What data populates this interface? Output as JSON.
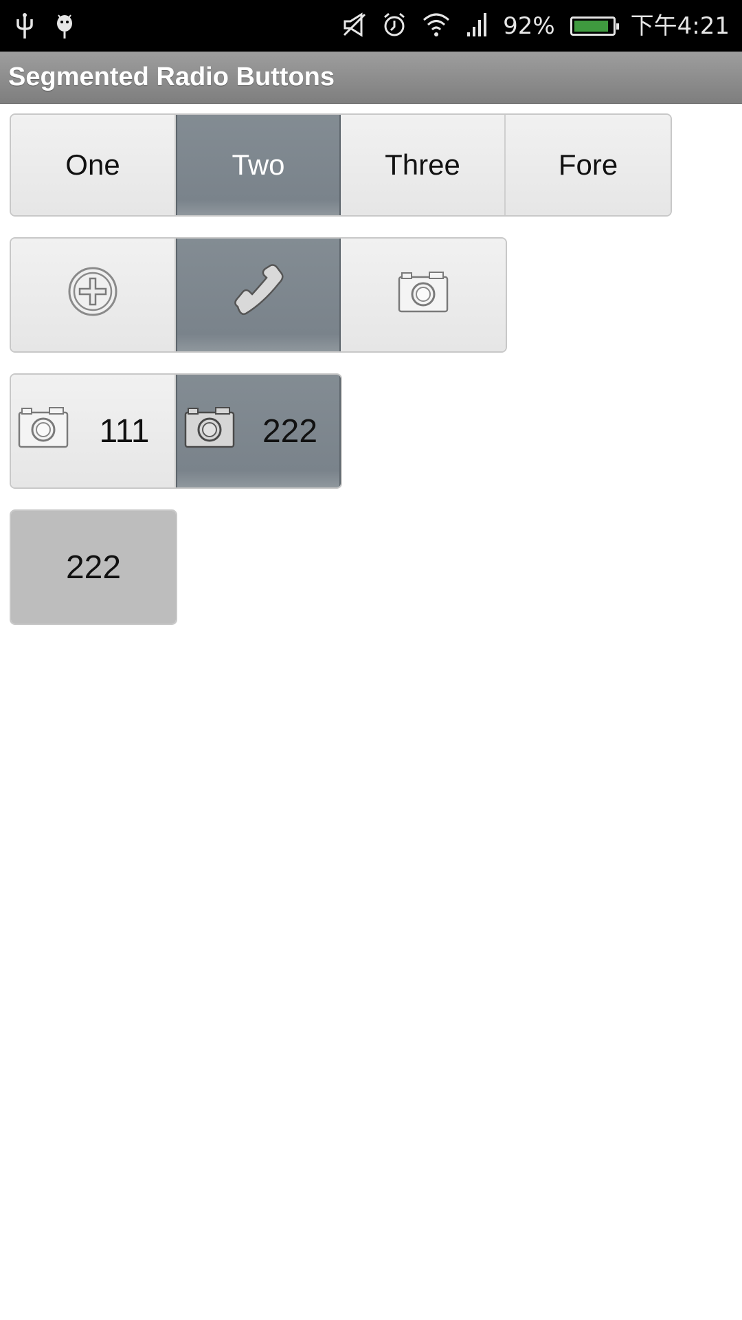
{
  "status_bar": {
    "battery_percent": "92%",
    "battery_level": 0.92,
    "time": "下午4:21",
    "icons": [
      "usb-icon",
      "android-debug-icon",
      "mute-icon",
      "alarm-icon",
      "wifi-icon",
      "signal-icon",
      "battery-icon"
    ]
  },
  "app": {
    "title": "Segmented Radio Buttons"
  },
  "group1": {
    "segments": [
      "One",
      "Two",
      "Three",
      "Fore"
    ],
    "selected_index": 1
  },
  "group2": {
    "segments": [
      "add-icon",
      "phone-icon",
      "camera-icon"
    ],
    "selected_index": 1
  },
  "group3": {
    "segments": [
      "111",
      "222"
    ],
    "icons": [
      "camera-icon",
      "camera-icon"
    ],
    "selected_index": 1
  },
  "group4": {
    "segments": [
      "222"
    ]
  },
  "colors": {
    "selected": "#7f888f",
    "unselected": "#ececec",
    "grey_button": "#bdbdbd",
    "title_bar": "#8e8e8e"
  }
}
